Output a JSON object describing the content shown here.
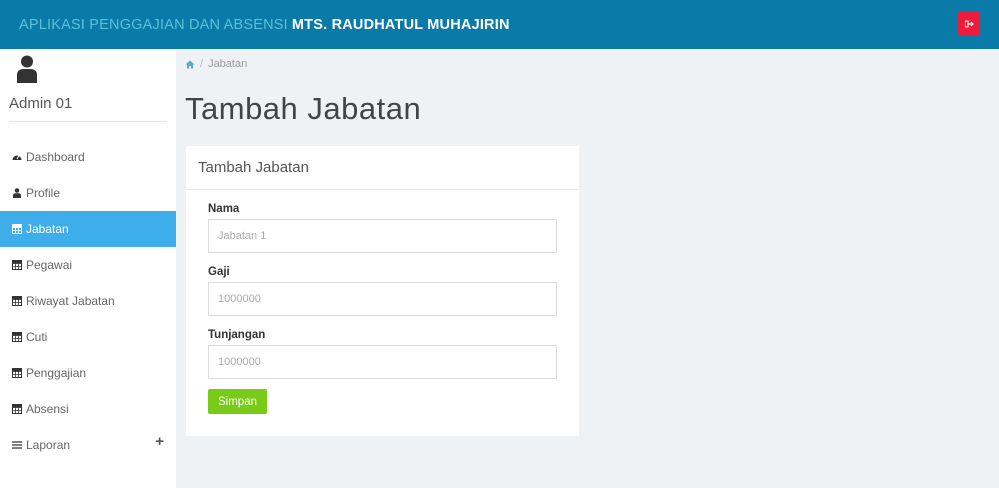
{
  "header": {
    "app_name": "APLIKASI PENGGAJIAN DAN ABSENSI",
    "school_name": "MTS. RAUDHATUL MUHAJIRIN",
    "logout_icon": "logout-icon"
  },
  "sidebar": {
    "user_name": "Admin 01",
    "items": [
      {
        "label": "Dashboard",
        "icon": "dashboard-icon"
      },
      {
        "label": "Profile",
        "icon": "user-icon"
      },
      {
        "label": "Jabatan",
        "icon": "table-icon",
        "active": true
      },
      {
        "label": "Pegawai",
        "icon": "table-icon"
      },
      {
        "label": "Riwayat Jabatan",
        "icon": "table-icon"
      },
      {
        "label": "Cuti",
        "icon": "table-icon"
      },
      {
        "label": "Penggajian",
        "icon": "table-icon"
      },
      {
        "label": "Absensi",
        "icon": "table-icon"
      },
      {
        "label": "Laporan",
        "icon": "bars-icon",
        "expand": "+"
      }
    ]
  },
  "breadcrumb": {
    "current": "Jabatan"
  },
  "page": {
    "title": "Tambah Jabatan"
  },
  "form": {
    "panel_title": "Tambah Jabatan",
    "nama_label": "Nama",
    "nama_placeholder": "Jabatan 1",
    "gaji_label": "Gaji",
    "gaji_placeholder": "1000000",
    "tunjangan_label": "Tunjangan",
    "tunjangan_placeholder": "1000000",
    "submit_label": "Simpan"
  },
  "colors": {
    "header_bg": "#0a7aa8",
    "active_item": "#3daee9",
    "save_button": "#78cc18",
    "logout_button": "#ef1a3c"
  }
}
